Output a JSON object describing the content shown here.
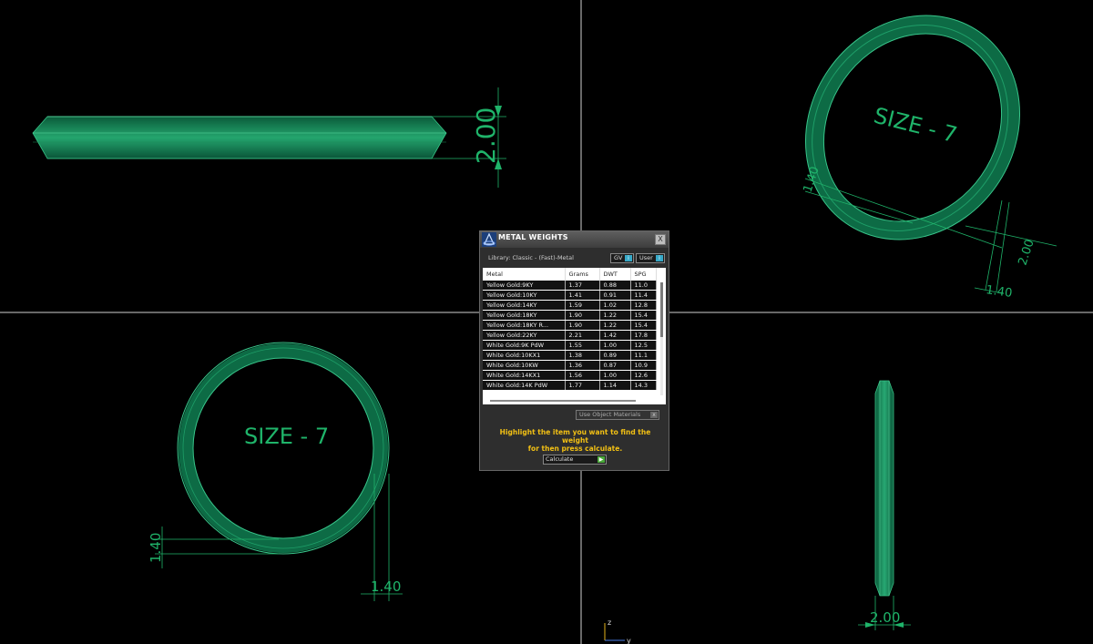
{
  "viewport": {
    "dims": {
      "front_height": "2.00",
      "persp_width": "2.00",
      "persp_height_left": "1.40",
      "persp_height_bottom": "1.40",
      "top_height": "1.40",
      "top_width": "1.40",
      "side_width": "2.00"
    },
    "labels": {
      "persp_size": "SIZE - 7",
      "top_size": "SIZE - 7"
    },
    "axis": {
      "z": "z",
      "y": "y"
    },
    "colors": {
      "ring": "#0d6b45",
      "dimension": "#1fb46a",
      "background": "#000000"
    }
  },
  "dialog": {
    "title": "METAL WEIGHTS",
    "close_label": "X",
    "library_label": "Library: Classic - (Fast)-Metal",
    "gv_label": "GV",
    "gv_icon": "i",
    "user_label": "User",
    "user_icon": "i",
    "table": {
      "headers": [
        "Metal",
        "Grams",
        "DWT",
        "SPG"
      ],
      "rows": [
        [
          "Yellow Gold:9KY",
          "1.37",
          "0.88",
          "11.0"
        ],
        [
          "Yellow Gold:10KY",
          "1.41",
          "0.91",
          "11.4"
        ],
        [
          "Yellow Gold:14KY",
          "1.59",
          "1.02",
          "12.8"
        ],
        [
          "Yellow Gold:18KY",
          "1.90",
          "1.22",
          "15.4"
        ],
        [
          "Yellow Gold:18KY R...",
          "1.90",
          "1.22",
          "15.4"
        ],
        [
          "Yellow Gold:22KY",
          "2.21",
          "1.42",
          "17.8"
        ],
        [
          "White Gold:9K PdW",
          "1.55",
          "1.00",
          "12.5"
        ],
        [
          "White Gold:10KX1",
          "1.38",
          "0.89",
          "11.1"
        ],
        [
          "White Gold:10KW",
          "1.36",
          "0.87",
          "10.9"
        ],
        [
          "White Gold:14KX1",
          "1.56",
          "1.00",
          "12.6"
        ],
        [
          "White Gold:14K PdW",
          "1.77",
          "1.14",
          "14.3"
        ]
      ]
    },
    "use_object_label": "Use Object Materials",
    "use_object_icon": "x",
    "hint_line1": "Highlight the item you want to find the weight",
    "hint_line2": "for then press calculate.",
    "calculate_label": "Calculate",
    "calculate_icon": "▶"
  }
}
